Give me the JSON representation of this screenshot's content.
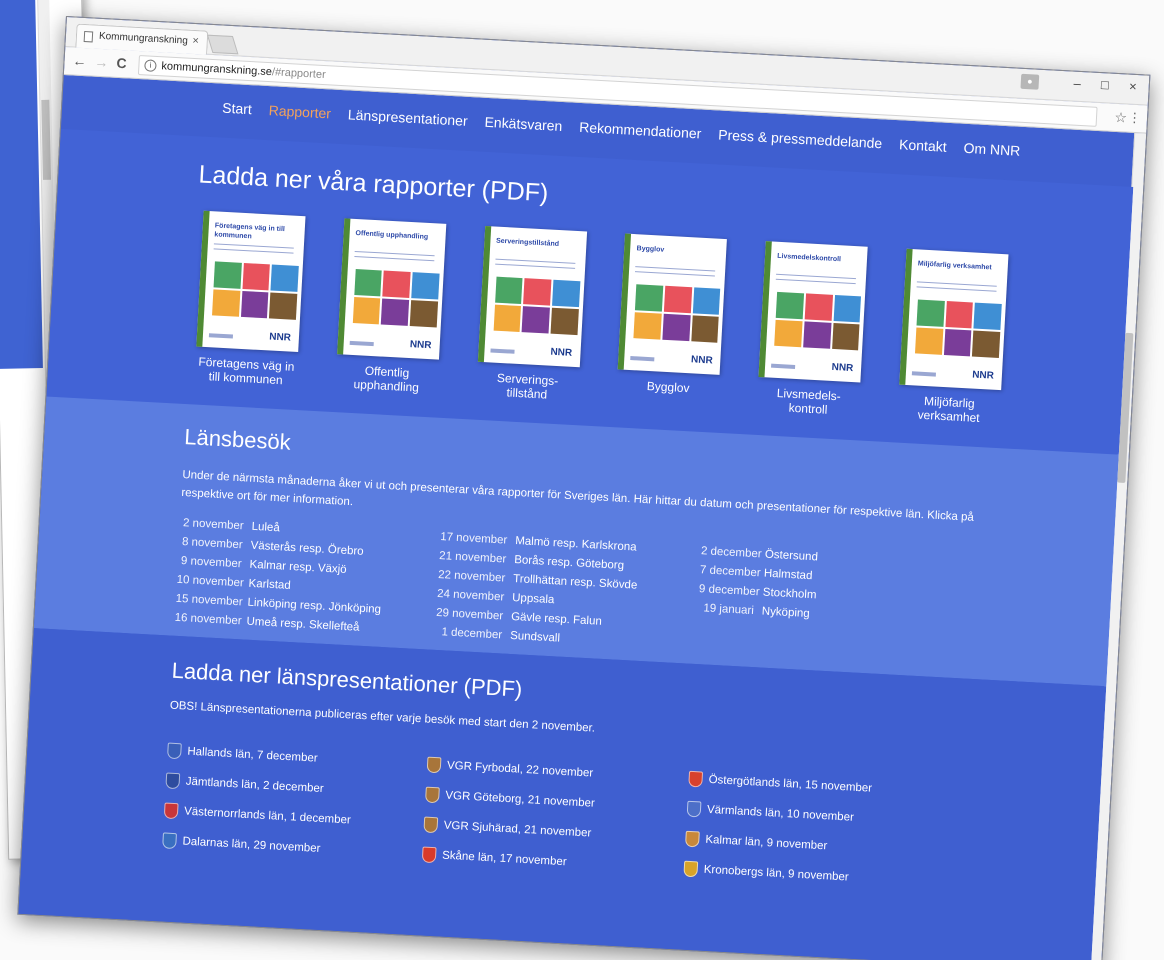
{
  "browser": {
    "tab_title": "Kommungranskning",
    "tab_close": "×",
    "url_host": "kommungranskning.se",
    "url_path": "/#rapporter",
    "back": "←",
    "forward": "→",
    "reload": "C",
    "star": "☆",
    "menu": "⋮",
    "minimize": "–",
    "maximize": "□",
    "close": "×"
  },
  "nav": [
    {
      "label": "Start",
      "active": false
    },
    {
      "label": "Rapporter",
      "active": true
    },
    {
      "label": "Länspresentationer",
      "active": false
    },
    {
      "label": "Enkätsvaren",
      "active": false
    },
    {
      "label": "Rekommendationer",
      "active": false
    },
    {
      "label": "Press & pressmeddelande",
      "active": false
    },
    {
      "label": "Kontakt",
      "active": false
    },
    {
      "label": "Om NNR",
      "active": false
    }
  ],
  "reports": {
    "heading": "Ladda ner våra rapporter (PDF)",
    "items": [
      {
        "cover_title": "Företagens väg in till kommunen",
        "line1": "Företagens väg in",
        "line2": "till kommunen"
      },
      {
        "cover_title": "Offentlig upphandling",
        "line1": "Offentlig",
        "line2": "upphandling"
      },
      {
        "cover_title": "Serveringstillstånd",
        "line1": "Serverings-",
        "line2": "tillstånd"
      },
      {
        "cover_title": "Bygglov",
        "line1": "Bygglov",
        "line2": ""
      },
      {
        "cover_title": "Livsmedelskontroll",
        "line1": "Livsmedels-",
        "line2": "kontroll"
      },
      {
        "cover_title": "Miljöfarlig verksamhet",
        "line1": "Miljöfarlig",
        "line2": "verksamhet"
      }
    ],
    "logo_text": "NNR"
  },
  "visits": {
    "heading": "Länsbesök",
    "intro": "Under de närmsta månaderna åker vi ut och presenterar våra rapporter för Sveriges län. Här hittar du datum och presentationer för respektive län. Klicka på respektive ort för mer information.",
    "columns": [
      [
        {
          "date": "2 november",
          "place": "Luleå"
        },
        {
          "date": "8 november",
          "place": "Västerås resp. Örebro"
        },
        {
          "date": "9 november",
          "place": "Kalmar resp. Växjö"
        },
        {
          "date": "10 november",
          "place": "Karlstad"
        },
        {
          "date": "15 november",
          "place": "Linköping resp. Jönköping"
        },
        {
          "date": "16 november",
          "place": "Umeå resp. Skellefteå"
        }
      ],
      [
        {
          "date": "17 november",
          "place": "Malmö resp. Karlskrona"
        },
        {
          "date": "21 november",
          "place": "Borås resp. Göteborg"
        },
        {
          "date": "22 november",
          "place": "Trollhättan resp. Skövde"
        },
        {
          "date": "24 november",
          "place": "Uppsala"
        },
        {
          "date": "29 november",
          "place": "Gävle resp. Falun"
        },
        {
          "date": "1 december",
          "place": "Sundsvall"
        }
      ],
      [
        {
          "date": "2 december",
          "place": "Östersund"
        },
        {
          "date": "7 december",
          "place": "Halmstad"
        },
        {
          "date": "9 december",
          "place": "Stockholm"
        },
        {
          "date": "19 januari",
          "place": "Nyköping"
        }
      ]
    ]
  },
  "presentations": {
    "heading": "Ladda ner länspresentationer (PDF)",
    "note": "OBS! Länspresentationerna publiceras efter varje besök med start den 2 november.",
    "columns": [
      [
        {
          "label": "Hallands län, 7 december",
          "crest_color": "#3a5fb8"
        },
        {
          "label": "Jämtlands län, 2 december",
          "crest_color": "#2e4c9e"
        },
        {
          "label": "Västernorrlands län, 1 december",
          "crest_color": "#c8363a"
        },
        {
          "label": "Dalarnas län, 29 november",
          "crest_color": "#3a6fc0"
        }
      ],
      [
        {
          "label": "VGR Fyrbodal, 22 november",
          "crest_color": "#a8753a"
        },
        {
          "label": "VGR Göteborg, 21 november",
          "crest_color": "#a8753a"
        },
        {
          "label": "VGR Sjuhärad, 21 november",
          "crest_color": "#a8753a"
        },
        {
          "label": "Skåne län, 17 november",
          "crest_color": "#d83a2a"
        }
      ],
      [
        {
          "label": "Östergötlands län, 15 november",
          "crest_color": "#d8412c"
        },
        {
          "label": "Värmlands län, 10 november",
          "crest_color": "#4d6fc8"
        },
        {
          "label": "Kalmar län, 9 november",
          "crest_color": "#c8883a"
        },
        {
          "label": "Kronobergs län, 9 november",
          "crest_color": "#d8a32a"
        }
      ]
    ]
  }
}
